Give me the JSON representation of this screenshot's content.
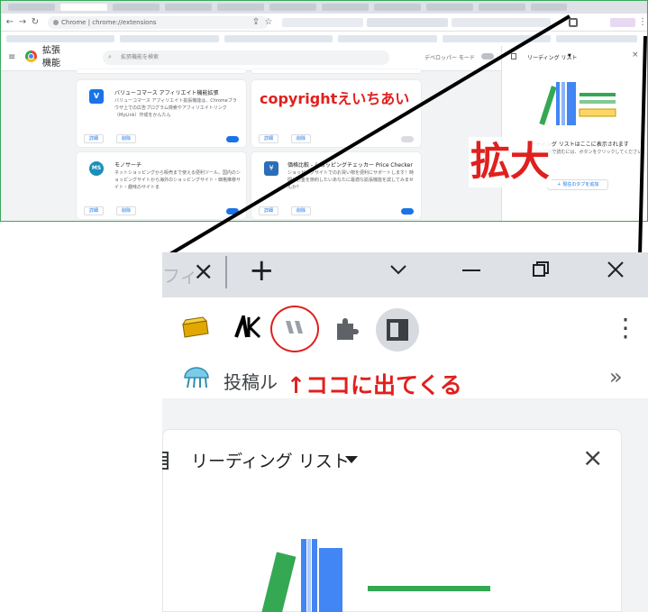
{
  "top_screenshot": {
    "toolbar": {
      "address_prefix": "Chrome",
      "address_url": "chrome://extensions"
    },
    "extensions_page": {
      "title": "拡張機能",
      "search_placeholder": "拡張機能を検索",
      "developer_mode_label": "デベロッパー モード",
      "cards": [
        {
          "name": "バリューコマース アフィリエイト機能拡張",
          "description": "バリューコマース アフィリエイト拡張機能は、Chromeブラウザ上での広告プログラム検索やアフィリエイトリンク（MyLink）作成をかんたん",
          "details_label": "詳細",
          "remove_label": "削除",
          "enabled": true
        },
        {
          "name": "",
          "description": "",
          "details_label": "詳細",
          "remove_label": "削除",
          "enabled": false
        },
        {
          "name": "モノサーチ",
          "description": "ネットショッピングから販売まで使える便利ツール。国内のショッピングサイトから海外のショッピングサイト・価格推移サイト・趣味のサイトま",
          "details_label": "詳細",
          "remove_label": "削除",
          "enabled": true
        },
        {
          "name": "価格比較 - ショッピングチェッカー Price Checker",
          "description": "ショッピングサイトでのお買い物を便利にサポートします！時間とお金を節約したいあなたに最適な拡張機能を試してみませんか？",
          "details_label": "詳細",
          "remove_label": "削除",
          "enabled": true
        }
      ]
    },
    "reading_list": {
      "title": "リーディング リスト",
      "empty_title": "リーディング リストはここに表示されます",
      "empty_desc": "ページを保存して後で読むには、ボタンをクリックしてください",
      "add_button": "＋ 現在のタブを追加"
    }
  },
  "annotations": {
    "copyright": "copyrightえいちあい",
    "zoom_label": "拡大",
    "arrow_note": "↑ココに出てくる"
  },
  "zoom_screenshot": {
    "tab_fragment": "フィ",
    "close_tab_glyph": "×",
    "new_tab_glyph": "+",
    "bookmark_label": "投稿ル",
    "more_bookmarks_glyph": "»",
    "reading_list_title": "リーディング リスト",
    "reading_list_close_glyph": "×",
    "ak_icon_text": "AK"
  },
  "colors": {
    "annotation_red": "#e0201e",
    "frame_green": "#3aa85a",
    "chrome_blue": "#1a73e8",
    "book_green": "#34a853",
    "book_blue": "#4285f4"
  }
}
